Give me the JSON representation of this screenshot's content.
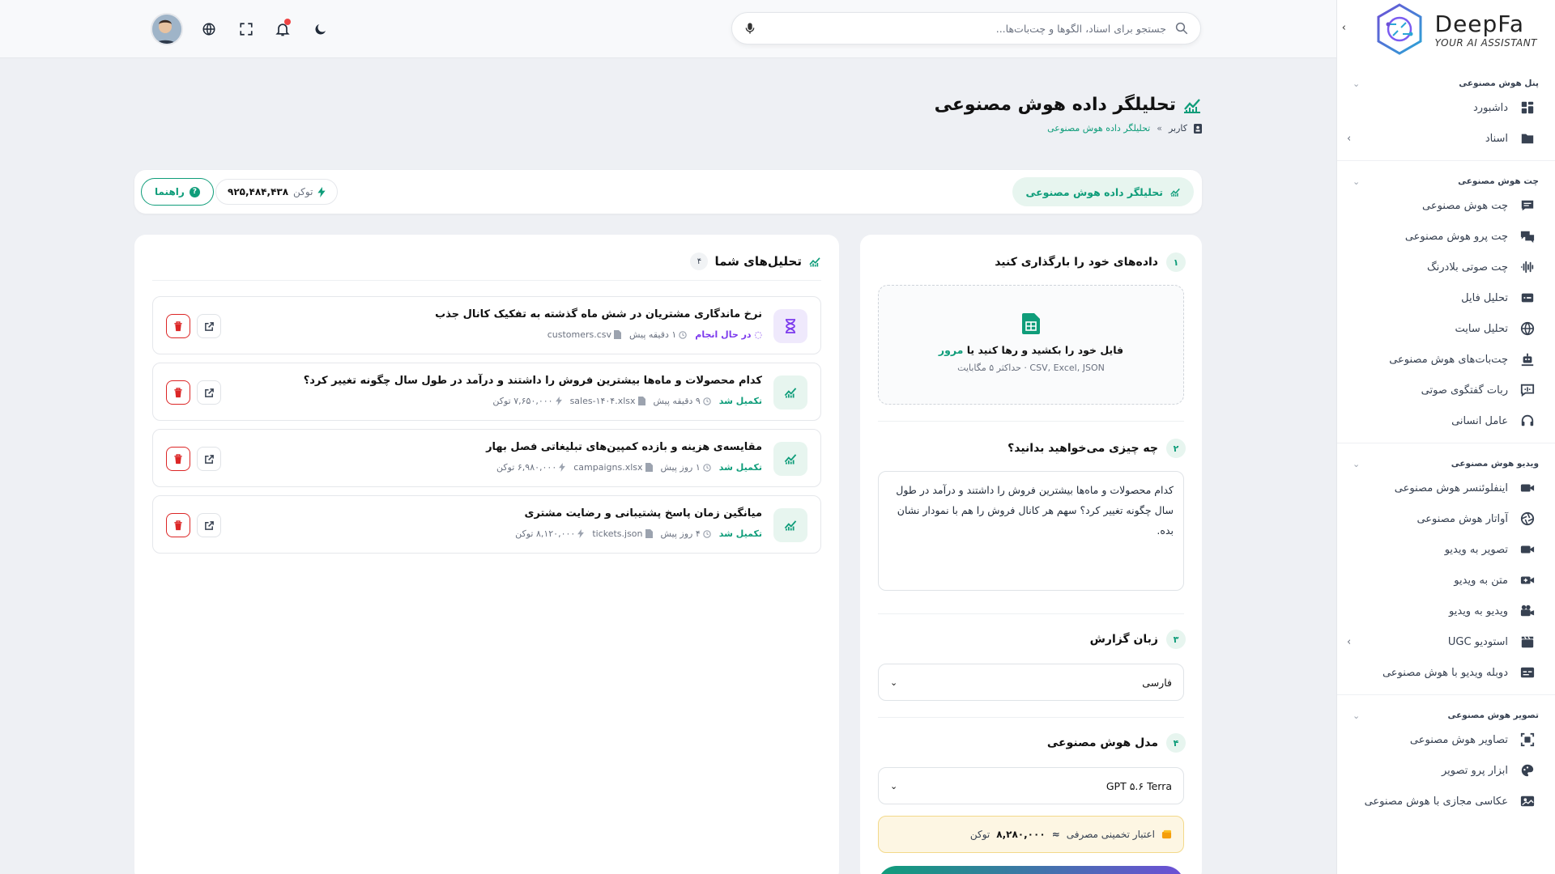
{
  "brand": {
    "name": "DeepFa",
    "tagline": "YOUR AI ASSISTANT"
  },
  "search": {
    "placeholder": "جستجو برای اسناد، الگوها و چت‌بات‌ها..."
  },
  "sidebar": {
    "sections": [
      {
        "title": "پنل هوش مصنوعی",
        "items": [
          {
            "label": "داشبورد",
            "icon": "dashboard-icon"
          },
          {
            "label": "اسناد",
            "icon": "folder-icon",
            "has_arrow": true
          }
        ]
      },
      {
        "title": "چت هوش مصنوعی",
        "items": [
          {
            "label": "چت هوش مصنوعی",
            "icon": "chat-icon"
          },
          {
            "label": "چت پرو هوش مصنوعی",
            "icon": "chat-pro-icon"
          },
          {
            "label": "چت صوتی بلادرنگ",
            "icon": "audio-wave-icon"
          },
          {
            "label": "تحلیل فایل",
            "icon": "file-analysis-icon"
          },
          {
            "label": "تحلیل سایت",
            "icon": "globe-icon"
          },
          {
            "label": "چت‌بات‌های هوش مصنوعی",
            "icon": "bot-icon"
          },
          {
            "label": "ربات گفتگوی صوتی",
            "icon": "voice-bot-icon"
          },
          {
            "label": "عامل انسانی",
            "icon": "headset-icon"
          }
        ]
      },
      {
        "title": "ویدیو هوش مصنوعی",
        "items": [
          {
            "label": "اینفلوئنسر هوش مصنوعی",
            "icon": "camera-icon"
          },
          {
            "label": "آواتار هوش مصنوعی",
            "icon": "aperture-icon"
          },
          {
            "label": "تصویر به ویدیو",
            "icon": "video-icon"
          },
          {
            "label": "متن به ویدیو",
            "icon": "video-plus-icon"
          },
          {
            "label": "ویدیو به ویدیو",
            "icon": "film-camera-icon"
          },
          {
            "label": "استودیو UGC",
            "icon": "clapper-icon",
            "has_arrow": true
          },
          {
            "label": "دوبله ویدیو با هوش مصنوعی",
            "icon": "subtitles-icon"
          }
        ]
      },
      {
        "title": "تصویر هوش مصنوعی",
        "items": [
          {
            "label": "تصاویر هوش مصنوعی",
            "icon": "image-scan-icon"
          },
          {
            "label": "ابزار پرو تصویر",
            "icon": "palette-icon"
          },
          {
            "label": "عکاسی مجازی با هوش مصنوعی",
            "icon": "photo-icon"
          }
        ]
      }
    ]
  },
  "page": {
    "title": "تحلیلگر داده هوش مصنوعی",
    "breadcrumb": {
      "root": "کاربر",
      "sep": "»",
      "current": "تحلیلگر داده هوش مصنوعی"
    }
  },
  "toolbar": {
    "tool_label": "تحلیلگر داده هوش مصنوعی",
    "token_label": "توکن",
    "token_value": "۹۲۵,۴۸۴,۴۳۸",
    "guide_label": "راهنما"
  },
  "form": {
    "step1": {
      "num": "۱",
      "title": "داده‌های خود را بارگذاری کنید"
    },
    "dropzone": {
      "main": "فایل خود را بکشید و رها کنید یا ",
      "link": "مرور",
      "sub": "CSV, Excel, JSON · حداکثر ۵ مگابایت"
    },
    "step2": {
      "num": "۲",
      "title": "چه چیزی می‌خواهید بدانید؟"
    },
    "question": "کدام محصولات و ماه‌ها بیشترین فروش را داشتند و درآمد در طول سال چگونه تغییر کرد؟ سهم هر کانال فروش را هم با نمودار نشان بده.",
    "step3": {
      "num": "۳",
      "title": "زبان گزارش"
    },
    "language": "فارسی",
    "step4": {
      "num": "۴",
      "title": "مدل هوش مصنوعی"
    },
    "model": "GPT ۵.۶ Terra",
    "estimate": {
      "label": "اعتبار تخمینی مصرفی",
      "approx": "≈",
      "value": "۸,۲۸۰,۰۰۰",
      "unit": "توکن"
    }
  },
  "analyses": {
    "title": "تحلیل‌های شما",
    "count": "۴",
    "items": [
      {
        "title": "نرخ ماندگاری مشتریان در شش ماه گذشته به تفکیک کانال جذب",
        "status": "در حال انجام",
        "state": "running",
        "time": "۱ دقیقه پیش",
        "file": "customers.csv",
        "tokens": ""
      },
      {
        "title": "کدام محصولات و ماه‌ها بیشترین فروش را داشتند و درآمد در طول سال چگونه تغییر کرد؟",
        "status": "تکمیل شد",
        "state": "done",
        "time": "۹ دقیقه پیش",
        "file": "sales-۱۴۰۴.xlsx",
        "tokens": "۷,۶۵۰,۰۰۰ توکن"
      },
      {
        "title": "مقایسه‌ی هزینه و بازده کمپین‌های تبلیغاتی فصل بهار",
        "status": "تکمیل شد",
        "state": "done",
        "time": "۱ روز پیش",
        "file": "campaigns.xlsx",
        "tokens": "۶,۹۸۰,۰۰۰ توکن"
      },
      {
        "title": "میانگین زمان پاسخ پشتیبانی و رضایت مشتری",
        "status": "تکمیل شد",
        "state": "done",
        "time": "۴ روز پیش",
        "file": "tickets.json",
        "tokens": "۸,۱۲۰,۰۰۰ توکن"
      }
    ]
  },
  "colors": {
    "accent": "#0f9d7a",
    "purple": "#7c3aed",
    "danger": "#dc2626"
  }
}
